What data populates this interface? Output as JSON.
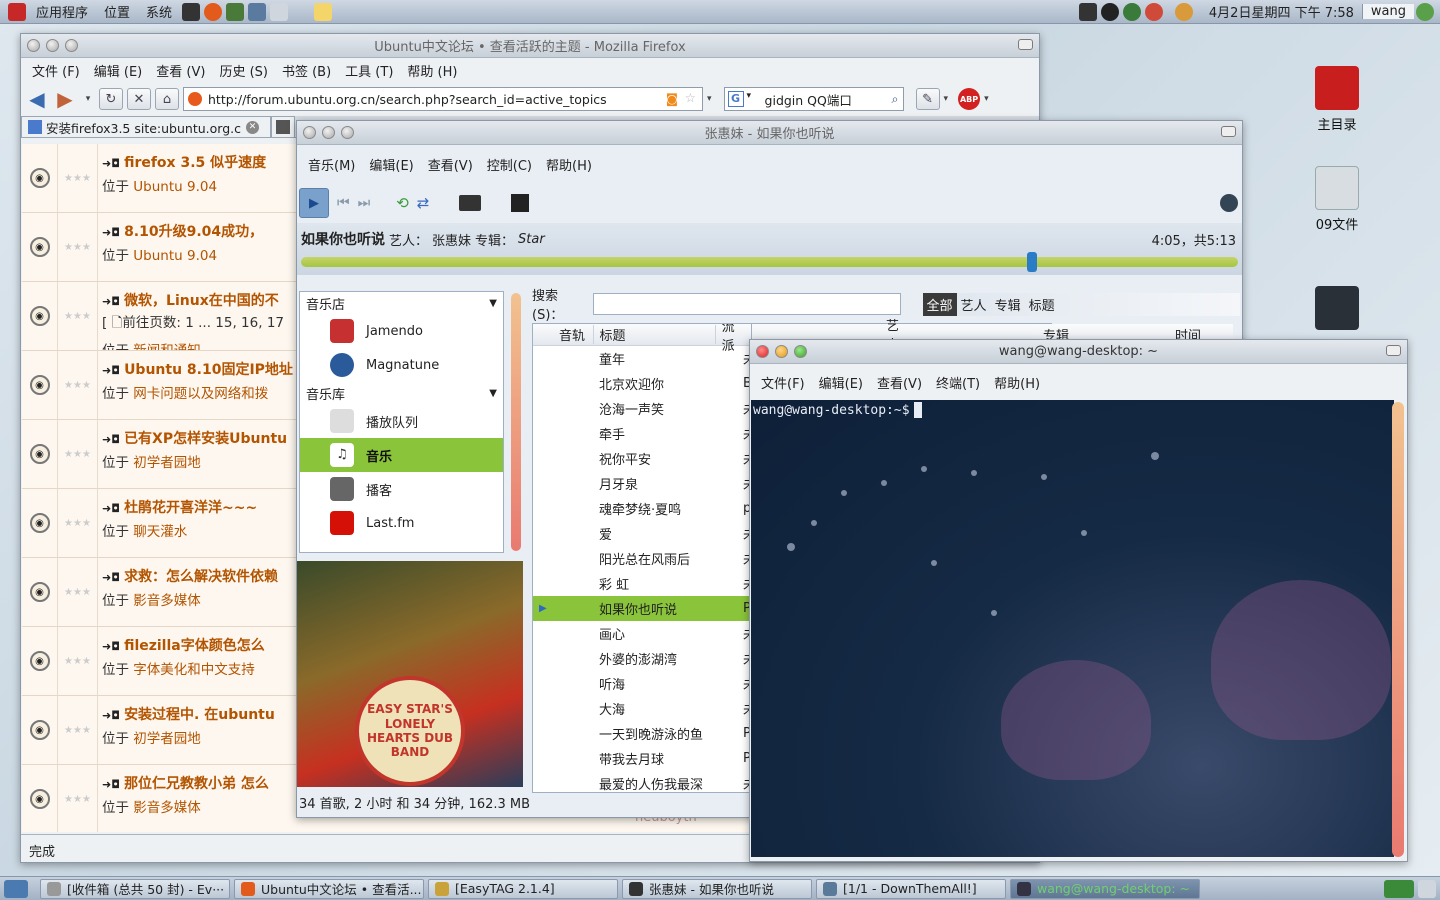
{
  "top_panel": {
    "menus": [
      "应用程序",
      "位置",
      "系统"
    ],
    "clock": "4月2日星期四 下午 7:58",
    "user": "wang"
  },
  "desktop_icons": [
    {
      "name": "主目录",
      "icon": "red-book-icon",
      "color": "#c81e1e"
    },
    {
      "name": "09文件",
      "icon": "document-icon",
      "color": "#d8dde2"
    },
    {
      "name": "",
      "icon": "folder-icon",
      "color": "#2a3038"
    }
  ],
  "firefox": {
    "title": "Ubuntu中文论坛 • 查看活跃的主题 - Mozilla Firefox",
    "menus": [
      "文件 (F)",
      "编辑 (E)",
      "查看 (V)",
      "历史 (S)",
      "书签 (B)",
      "工具 (T)",
      "帮助 (H)"
    ],
    "url": "http://forum.ubuntu.org.cn/search.php?search_id=active_topics",
    "search_value": "gidgin QQ端口",
    "tab_label": "安装firefox3.5 site:ubuntu.org.c···",
    "status": "完成",
    "topics": [
      {
        "title": "firefox 3.5 似乎速度",
        "location_prefix": "位于 ",
        "location": "Ubuntu 9.04"
      },
      {
        "title": "8.10升级9.04成功，",
        "location_prefix": "位于 ",
        "location": "Ubuntu 9.04"
      },
      {
        "title": "微软，Linux在中国的不",
        "pages": "[ 🗋前往页数: 1 ... 15, 16, 17",
        "location_prefix": "位于 ",
        "location": "新闻和通知"
      },
      {
        "title": "Ubuntu 8.10固定IP地址",
        "location_prefix": "位于 ",
        "location": "网卡问题以及网络和拨"
      },
      {
        "title": "已有XP怎样安装Ubuntu",
        "location_prefix": "位于 ",
        "location": "初学者园地"
      },
      {
        "title": "杜鹃花开喜洋洋~~~",
        "location_prefix": "位于 ",
        "location": "聊天灌水"
      },
      {
        "title": "求救：怎么解决软件依赖",
        "location_prefix": "位于 ",
        "location": "影音多媒体"
      },
      {
        "title": "filezilla字体颜色怎么",
        "location_prefix": "位于 ",
        "location": "字体美化和中文支持"
      },
      {
        "title": "安装过程中. 在ubuntu",
        "location_prefix": "位于 ",
        "location": "初学者园地"
      },
      {
        "title": "那位仁兄教教小弟 怎么",
        "location_prefix": "位于 ",
        "location": "影音多媒体"
      }
    ],
    "bottom_fragment": "neuboyth"
  },
  "rhythmbox": {
    "title": "张惠妹 - 如果你也听说",
    "menus": [
      "音乐(M)",
      "编辑(E)",
      "查看(V)",
      "控制(C)",
      "帮助(H)"
    ],
    "now_playing": {
      "song": "如果你也听说",
      "artist_label": "艺人：",
      "artist": "张惠妹",
      "album_label": "专辑：",
      "album": "Star",
      "time": "4:05，共5:13",
      "progress": 0.78
    },
    "sources": {
      "store_header": "音乐店",
      "store": [
        "Jamendo",
        "Magnatune"
      ],
      "library_header": "音乐库",
      "library": [
        "播放队列",
        "音乐",
        "播客",
        "Last.fm"
      ],
      "selected": "音乐"
    },
    "album_art_text": "EASY STAR'S LONELY HEARTS DUB BAND",
    "search_label": "搜索(S)：",
    "search_value": "",
    "filters": [
      "全部",
      "艺人",
      "专辑",
      "标题"
    ],
    "columns": [
      "音轨",
      "标题",
      "流派",
      "艺人",
      "专辑",
      "时间"
    ],
    "songs": [
      {
        "title": "童年",
        "genre": "未"
      },
      {
        "title": "北京欢迎你",
        "genre": "B"
      },
      {
        "title": "沧海一声笑",
        "genre": "未"
      },
      {
        "title": "牵手",
        "genre": "未"
      },
      {
        "title": "祝你平安",
        "genre": "未"
      },
      {
        "title": "月牙泉",
        "genre": "未"
      },
      {
        "title": "魂牵梦绕·夏鸣",
        "genre": "p"
      },
      {
        "title": "爱",
        "genre": "未"
      },
      {
        "title": "阳光总在风雨后",
        "genre": "未"
      },
      {
        "title": "彩 虹",
        "genre": "未"
      },
      {
        "title": "如果你也听说",
        "genre": "P",
        "playing": true
      },
      {
        "title": "画心",
        "genre": "未"
      },
      {
        "title": "外婆的澎湖湾",
        "genre": "未"
      },
      {
        "title": "听海",
        "genre": "未"
      },
      {
        "title": "大海",
        "genre": "未"
      },
      {
        "title": "一天到晚游泳的鱼",
        "genre": "P"
      },
      {
        "title": "带我去月球",
        "genre": "P"
      },
      {
        "title": "最爱的人伤我最深",
        "genre": "未"
      }
    ],
    "status": "34 首歌, 2 小时 和 34 分钟, 162.3 MB"
  },
  "terminal": {
    "title": "wang@wang-desktop: ~",
    "menus": [
      "文件(F)",
      "编辑(E)",
      "查看(V)",
      "终端(T)",
      "帮助(H)"
    ],
    "prompt": "wang@wang-desktop:~$"
  },
  "taskbar": [
    {
      "label": "[收件箱 (总共 50 封) - Ev···",
      "icon": "mail-icon"
    },
    {
      "label": "Ubuntu中文论坛 • 查看活...",
      "icon": "firefox-icon"
    },
    {
      "label": "[EasyTAG 2.1.4]",
      "icon": "tag-icon"
    },
    {
      "label": "张惠妹 - 如果你也听说",
      "icon": "music-icon"
    },
    {
      "label": "[1/1 - DownThemAll!]",
      "icon": "download-icon"
    },
    {
      "label": "wang@wang-desktop: ~",
      "icon": "terminal-icon",
      "active": true
    }
  ]
}
